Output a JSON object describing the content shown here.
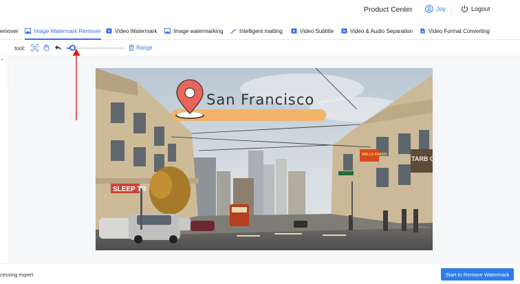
{
  "header": {
    "product_center": "Product Center",
    "user_name": "Joy",
    "logout_label": "Logout"
  },
  "tabs": [
    {
      "label": "emover",
      "active": false,
      "icon": "none"
    },
    {
      "label": "Image Watermark Remover",
      "active": true,
      "icon": "image-icon"
    },
    {
      "label": "Video Watermark",
      "active": false,
      "icon": "video-icon"
    },
    {
      "label": "Image watermarking",
      "active": false,
      "icon": "image-icon"
    },
    {
      "label": "Intelligent matting",
      "active": false,
      "icon": "magic-wand-icon"
    },
    {
      "label": "Video Subtitle",
      "active": false,
      "icon": "video-icon"
    },
    {
      "label": "Video & Audio Separation",
      "active": false,
      "icon": "video-icon"
    },
    {
      "label": "Video Format Converting",
      "active": false,
      "icon": "document-icon"
    }
  ],
  "toolbar": {
    "label": "tool:",
    "range_label": "Range",
    "brush_size_fraction": 0.1
  },
  "image": {
    "overlay_text": "San Francisco",
    "sign_text_1": "SLEEP TR",
    "sign_text_2": "WELLS FARGO",
    "sign_text_3": "TARB COF"
  },
  "footer": {
    "left_text": "cessing expert",
    "start_button": "Start to Remove Watermark"
  },
  "colors": {
    "accent": "#2f6fe4",
    "button": "#2f7de8",
    "pin": "#e8655a",
    "label_bar": "#f2b46a",
    "arrow": "#e02020"
  }
}
